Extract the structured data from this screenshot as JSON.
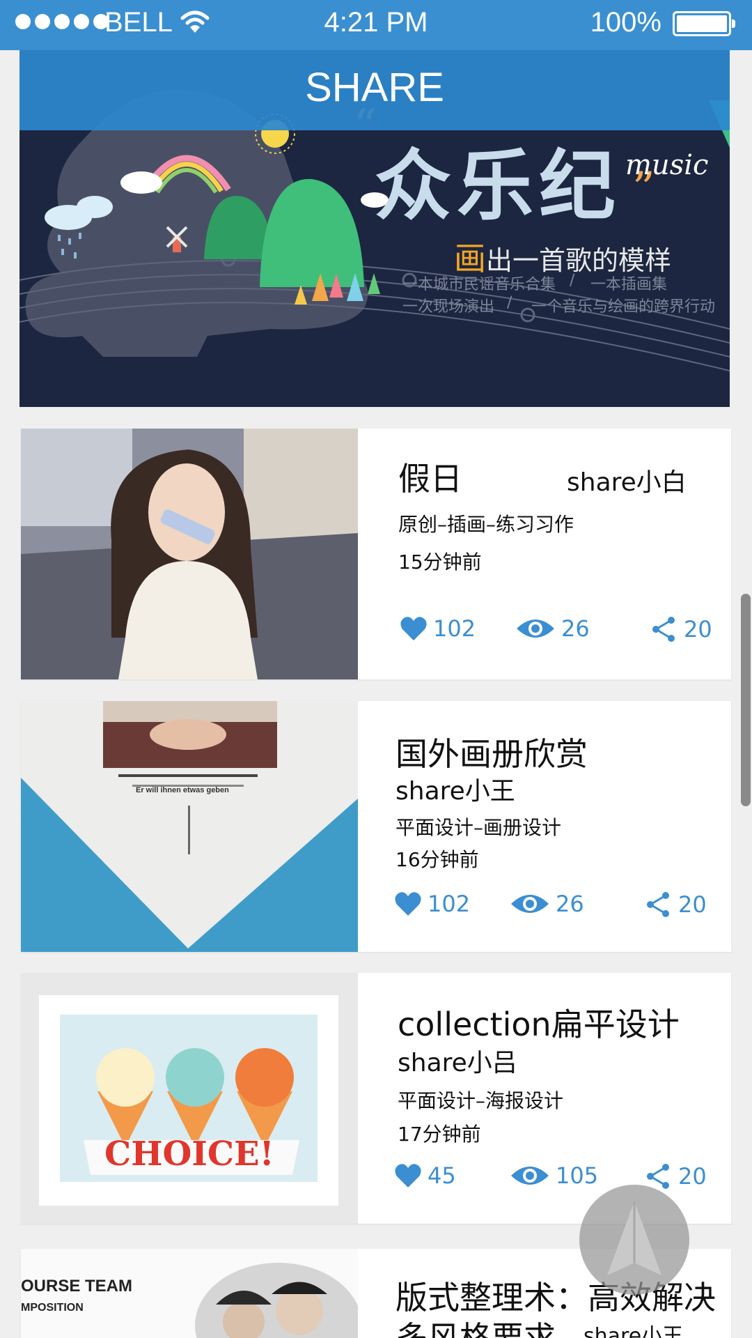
{
  "status_bar": {
    "carrier": "BELL",
    "time": "4:21 PM",
    "battery": "100%"
  },
  "header": {
    "title": "SHARE"
  },
  "banner": {
    "title": "众乐纪",
    "title_suffix": "music",
    "tagline_accent": "画",
    "tagline": "出一首歌的模样",
    "line1_a": "一本城市民谣音乐合集",
    "line1_b": "一本插画集",
    "line2_a": "一次现场演出",
    "line2_b": "一个音乐与绘画的跨界行动",
    "divider": "/"
  },
  "cards": [
    {
      "title": "假日",
      "author": "share小白",
      "tags": "原创–插画–练习习作",
      "time": "15分钟前",
      "likes": "102",
      "views": "26",
      "shares": "20"
    },
    {
      "title": "国外画册欣赏",
      "author": "share小王",
      "tags": "平面设计–画册设计",
      "time": "16分钟前",
      "likes": "102",
      "views": "26",
      "shares": "20",
      "thumb_caption": "Er will ihnen etwas geben"
    },
    {
      "title": "collection扁平设计",
      "author": "share小吕",
      "tags": "平面设计–海报设计",
      "time": "17分钟前",
      "likes": "45",
      "views": "105",
      "shares": "20",
      "thumb_text": "CHOICE!"
    },
    {
      "title": "版式整理术：高效解决多风格要求",
      "title_line1": "版式整理术：高效解决",
      "title_line2": "多风格要求",
      "author": "share小王",
      "thumb_text_1": "OURSE TEAM",
      "thumb_text_2": "MPOSITION"
    }
  ],
  "colors": {
    "primary": "#3a8fd1",
    "stat": "#3b8ed1",
    "background": "#efefef"
  },
  "icons": [
    "wifi-icon",
    "battery-icon",
    "heart-icon",
    "eye-icon",
    "share-icon",
    "paper-plane-icon"
  ]
}
